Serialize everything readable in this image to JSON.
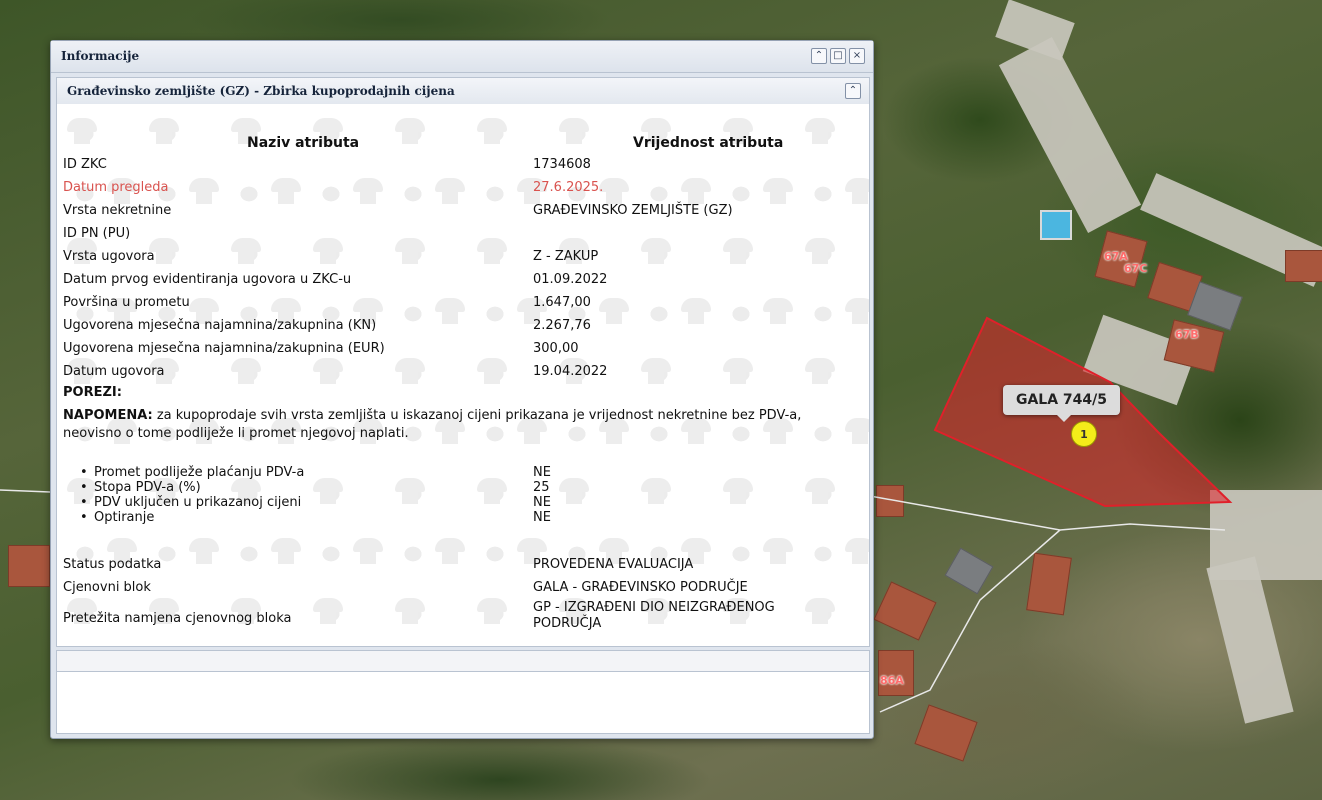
{
  "window": {
    "title": "Informacije",
    "panel_title": "Građevinsko zemljište (GZ) - Zbirka kupoprodajnih cijena",
    "controls": [
      "collapse",
      "maximize",
      "close"
    ]
  },
  "table": {
    "header_name": "Naziv atributa",
    "header_value": "Vrijednost atributa",
    "rows": [
      {
        "label": "ID ZKC",
        "value": "1734608"
      },
      {
        "label": "Datum pregleda",
        "value": "27.6.2025.",
        "highlight": "#d9534f"
      },
      {
        "label": "Vrsta nekretnine",
        "value": "GRAĐEVINSKO ZEMLJIŠTE (GZ)"
      },
      {
        "label": "ID PN (PU)",
        "value": ""
      },
      {
        "label": "Vrsta ugovora",
        "value": "Z - ZAKUP"
      },
      {
        "label": "Datum prvog evidentiranja ugovora u ZKC-u",
        "value": "01.09.2022"
      },
      {
        "label": "Površina u prometu",
        "value": "1.647,00"
      },
      {
        "label": "Ugovorena mjesečna najamnina/zakupnina (KN)",
        "value": "2.267,76"
      },
      {
        "label": "Ugovorena mjesečna najamnina/zakupnina (EUR)",
        "value": "300,00"
      },
      {
        "label": "Datum ugovora",
        "value": "19.04.2022"
      }
    ],
    "taxes_heading": "POREZI:",
    "note_bold": "NAPOMENA:",
    "note_text": " za kupoprodaje svih vrsta zemljišta u iskazanoj cijeni prikazana je vrijednost nekretnine bez PDV-a, neovisno o tome podliježe li promet njegovoj naplati.",
    "tax_items": [
      {
        "label": "Promet podliježe plaćanju PDV-a",
        "value": "NE"
      },
      {
        "label": "Stopa PDV-a (%)",
        "value": "25"
      },
      {
        "label": "PDV uključen u prikazanoj cijeni",
        "value": "NE"
      },
      {
        "label": "Optiranje",
        "value": "NE"
      }
    ],
    "footer_rows": [
      {
        "label": "Status podatka",
        "value": "PROVEDENA EVALUACIJA"
      },
      {
        "label": "Cjenovni blok",
        "value": "GALA - GRAĐEVINSKO PODRUČJE"
      },
      {
        "label": "Pretežita namjena cjenovnog bloka",
        "value_line1": "GP - IZGRAĐENI DIO NEIZGRAĐENOG",
        "value_line2": "PODRUČJA"
      }
    ]
  },
  "map": {
    "parcel_label": "GALA 744/5",
    "marker_number": "1",
    "house_numbers": [
      "67A",
      "67C",
      "67B",
      "86A"
    ],
    "parcel_color": "#e0202a"
  }
}
